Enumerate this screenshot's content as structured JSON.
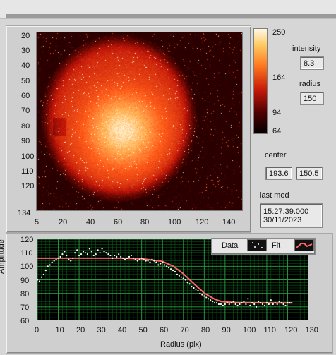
{
  "window": {
    "title": ""
  },
  "image_panel": {
    "y_ticks": [
      "20",
      "30",
      "40",
      "50",
      "60",
      "70",
      "80",
      "90",
      "100",
      "110",
      "120",
      "134"
    ],
    "x_ticks": [
      "5",
      "20",
      "40",
      "60",
      "80",
      "100",
      "120",
      "140"
    ],
    "colorbar_ticks": [
      "250",
      "164",
      "94",
      "64"
    ]
  },
  "right_panel": {
    "intensity_label": "intensity",
    "intensity_value": "8.3",
    "radius_label": "radius",
    "radius_value": "150",
    "center_label": "center",
    "center_x": "193.6",
    "center_y": "150.5",
    "last_mod_label": "last mod",
    "last_mod_time": "15:27:39.000",
    "last_mod_date": "30/11/2023"
  },
  "bottom_panel": {
    "legend_data_label": "Data",
    "legend_fit_label": "Fit",
    "xlabel": "Radius (pix)",
    "ylabel": "Amplitude"
  },
  "colors": {
    "background": "#d6d6d6",
    "panel": "#cfcfcf",
    "plot_bg": "#000000",
    "grid_green": "#0a5a17",
    "grid_green_light": "#2c9c40",
    "fit_line": "#ff6666",
    "data_points": "#ffffff",
    "colormap_low": "#0b0000",
    "colormap_mid": "#c11a0b",
    "colormap_high": "#fff1b8"
  },
  "chart_data": {
    "type": "scatter",
    "title": "",
    "xlabel": "Radius (pix)",
    "ylabel": "Amplitude",
    "xlim": [
      0,
      130
    ],
    "ylim": [
      60,
      120
    ],
    "grid": true,
    "legend": "top-right",
    "x_ticks": [
      0,
      10,
      20,
      30,
      40,
      50,
      60,
      70,
      80,
      90,
      100,
      110,
      120,
      130
    ],
    "y_ticks": [
      60,
      70,
      80,
      90,
      100,
      110,
      120
    ],
    "series": [
      {
        "name": "Data",
        "type": "scatter",
        "x": [
          0,
          1,
          2,
          3,
          4,
          5,
          6,
          7,
          8,
          9,
          10,
          11,
          12,
          13,
          14,
          15,
          16,
          17,
          18,
          19,
          20,
          21,
          22,
          23,
          24,
          25,
          26,
          27,
          28,
          29,
          30,
          31,
          32,
          33,
          34,
          35,
          36,
          37,
          38,
          39,
          40,
          41,
          42,
          43,
          44,
          45,
          46,
          47,
          48,
          49,
          50,
          51,
          52,
          53,
          54,
          55,
          56,
          57,
          58,
          59,
          60,
          61,
          62,
          63,
          64,
          65,
          66,
          67,
          68,
          69,
          70,
          71,
          72,
          73,
          74,
          75,
          76,
          77,
          78,
          79,
          80,
          81,
          82,
          83,
          84,
          85,
          86,
          87,
          88,
          89,
          90,
          91,
          92,
          93,
          94,
          95,
          96,
          97,
          98,
          99,
          100,
          101,
          102,
          103,
          104,
          105,
          106,
          107,
          108,
          109,
          110,
          111,
          112,
          113,
          114,
          115,
          116,
          117,
          118,
          119,
          120,
          121,
          122
        ],
        "y": [
          90,
          89,
          92,
          94,
          97,
          100,
          101,
          103,
          104,
          105,
          106,
          107,
          109,
          111,
          108,
          105,
          104,
          106,
          110,
          112,
          108,
          109,
          111,
          110,
          109,
          113,
          111,
          108,
          109,
          112,
          110,
          113,
          111,
          110,
          109,
          108,
          106,
          108,
          107,
          109,
          107,
          106,
          105,
          106,
          107,
          108,
          106,
          105,
          104,
          105,
          106,
          105,
          104,
          104,
          103,
          105,
          104,
          103,
          101,
          102,
          103,
          101,
          100,
          99,
          98,
          97,
          96,
          94,
          93,
          92,
          91,
          90,
          88,
          87,
          85,
          84,
          83,
          82,
          80,
          79,
          78,
          77,
          76,
          75,
          74,
          73,
          73,
          72,
          72,
          71,
          72,
          73,
          72,
          73,
          74,
          72,
          71,
          72,
          73,
          74,
          72,
          76,
          71,
          73,
          72,
          70,
          74,
          73,
          72,
          71,
          73,
          72,
          75,
          72,
          73,
          72,
          74,
          73,
          72,
          71,
          73,
          73,
          73
        ]
      },
      {
        "name": "Fit",
        "type": "line",
        "x": [
          0,
          10,
          20,
          30,
          40,
          50,
          55,
          60,
          65,
          70,
          75,
          80,
          85,
          88,
          90,
          95,
          100,
          110,
          120,
          122
        ],
        "y": [
          106,
          106,
          106,
          106,
          106,
          105.5,
          104.7,
          103.6,
          100.2,
          94.5,
          87.2,
          80.2,
          75.7,
          74.1,
          73.7,
          73.2,
          73.1,
          73,
          73,
          73
        ]
      }
    ]
  }
}
